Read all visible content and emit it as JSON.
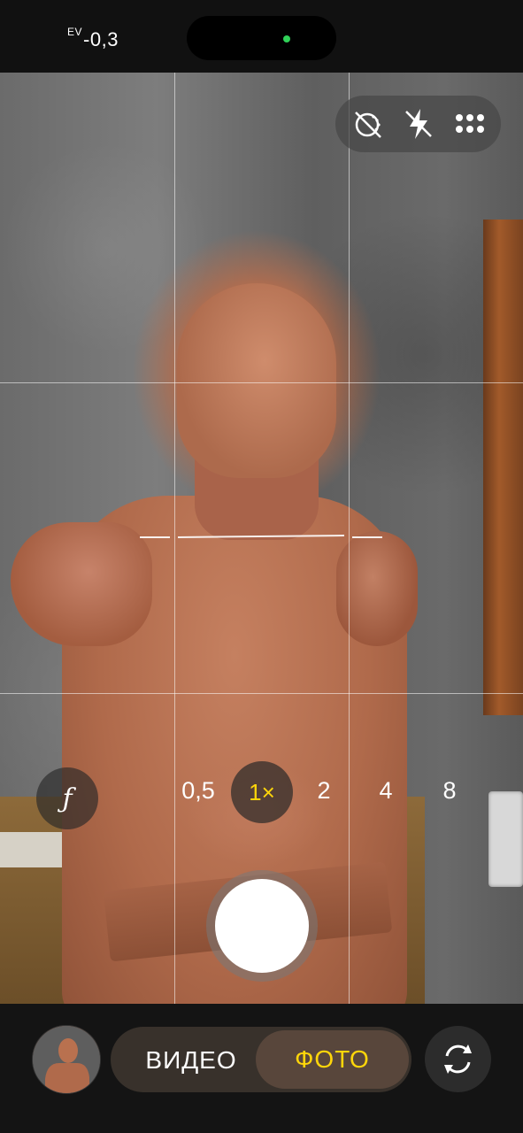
{
  "status": {
    "ev_prefix": "EV",
    "ev_value": "-0,3"
  },
  "controls": {
    "icons": [
      "live-photo-off-icon",
      "flash-off-icon",
      "more-options-icon"
    ]
  },
  "zoom": {
    "fstop_label": "ƒ",
    "options": [
      "0,5",
      "2",
      "4",
      "8"
    ],
    "active": "1×"
  },
  "modes": {
    "video": "ВИДЕО",
    "photo": "ФОТО",
    "selected": "photo"
  },
  "colors": {
    "accent": "#ffd60a",
    "status_dot": "#30d158"
  }
}
